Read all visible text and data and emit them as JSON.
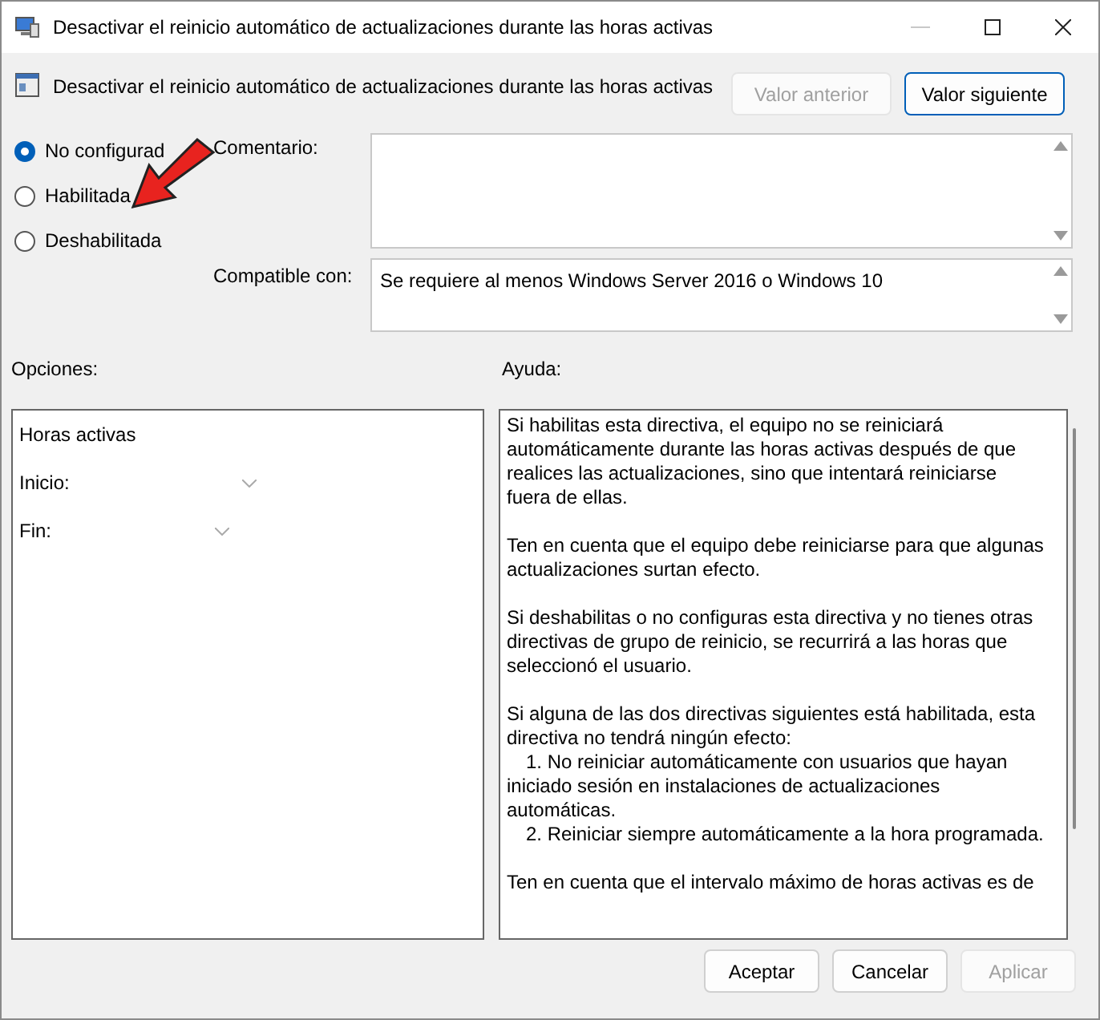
{
  "window": {
    "title": "Desactivar el reinicio automático de actualizaciones durante las horas activas"
  },
  "header": {
    "title": "Desactivar el reinicio automático de actualizaciones durante las horas activas",
    "buttons": [
      {
        "label": "Valor anterior",
        "disabled": true
      },
      {
        "label": "Valor siguiente",
        "disabled": false
      }
    ]
  },
  "state_options": [
    {
      "label": "No configurad",
      "selected": true
    },
    {
      "label": "Habilitada",
      "selected": false
    },
    {
      "label": "Deshabilitada",
      "selected": false
    }
  ],
  "comment": {
    "label": "Comentario:"
  },
  "compatible": {
    "label": "Compatible con:",
    "value": "Se requiere al menos Windows Server 2016 o Windows 10"
  },
  "options": {
    "label": "Opciones:",
    "title": "Horas activas",
    "fields": [
      {
        "label": "Inicio:"
      },
      {
        "label": "Fin:"
      }
    ]
  },
  "help": {
    "label": "Ayuda:",
    "paragraphs": [
      {
        "lines": [
          {
            "kind": "text",
            "text": "Si habilitas esta directiva, el equipo no se reiniciará automáticamente durante las horas activas después de que realices las actualizaciones, sino que intentará reiniciarse fuera de ellas."
          }
        ]
      },
      {
        "lines": [
          {
            "kind": "text",
            "text": "Ten en cuenta que el equipo debe reiniciarse para que algunas actualizaciones surtan efecto."
          }
        ]
      },
      {
        "lines": [
          {
            "kind": "text",
            "text": "Si deshabilitas o no configuras esta directiva y no tienes otras directivas de grupo de reinicio, se recurrirá a las horas que seleccionó el usuario."
          }
        ]
      },
      {
        "lines": [
          {
            "kind": "text",
            "text": "Si alguna de las dos directivas siguientes está habilitada, esta directiva no tendrá ningún efecto:"
          },
          {
            "kind": "item",
            "text": "1. No reiniciar automáticamente con usuarios que hayan iniciado sesión en instalaciones de actualizaciones automáticas."
          },
          {
            "kind": "item",
            "text": "2. Reiniciar siempre automáticamente a la hora programada."
          }
        ]
      },
      {
        "lines": [
          {
            "kind": "text",
            "text": "Ten en cuenta que el intervalo máximo de horas activas es de"
          }
        ]
      }
    ]
  },
  "footer": {
    "buttons": [
      {
        "label": "Aceptar",
        "disabled": false
      },
      {
        "label": "Cancelar",
        "disabled": false
      },
      {
        "label": "Aplicar",
        "disabled": true
      }
    ]
  }
}
